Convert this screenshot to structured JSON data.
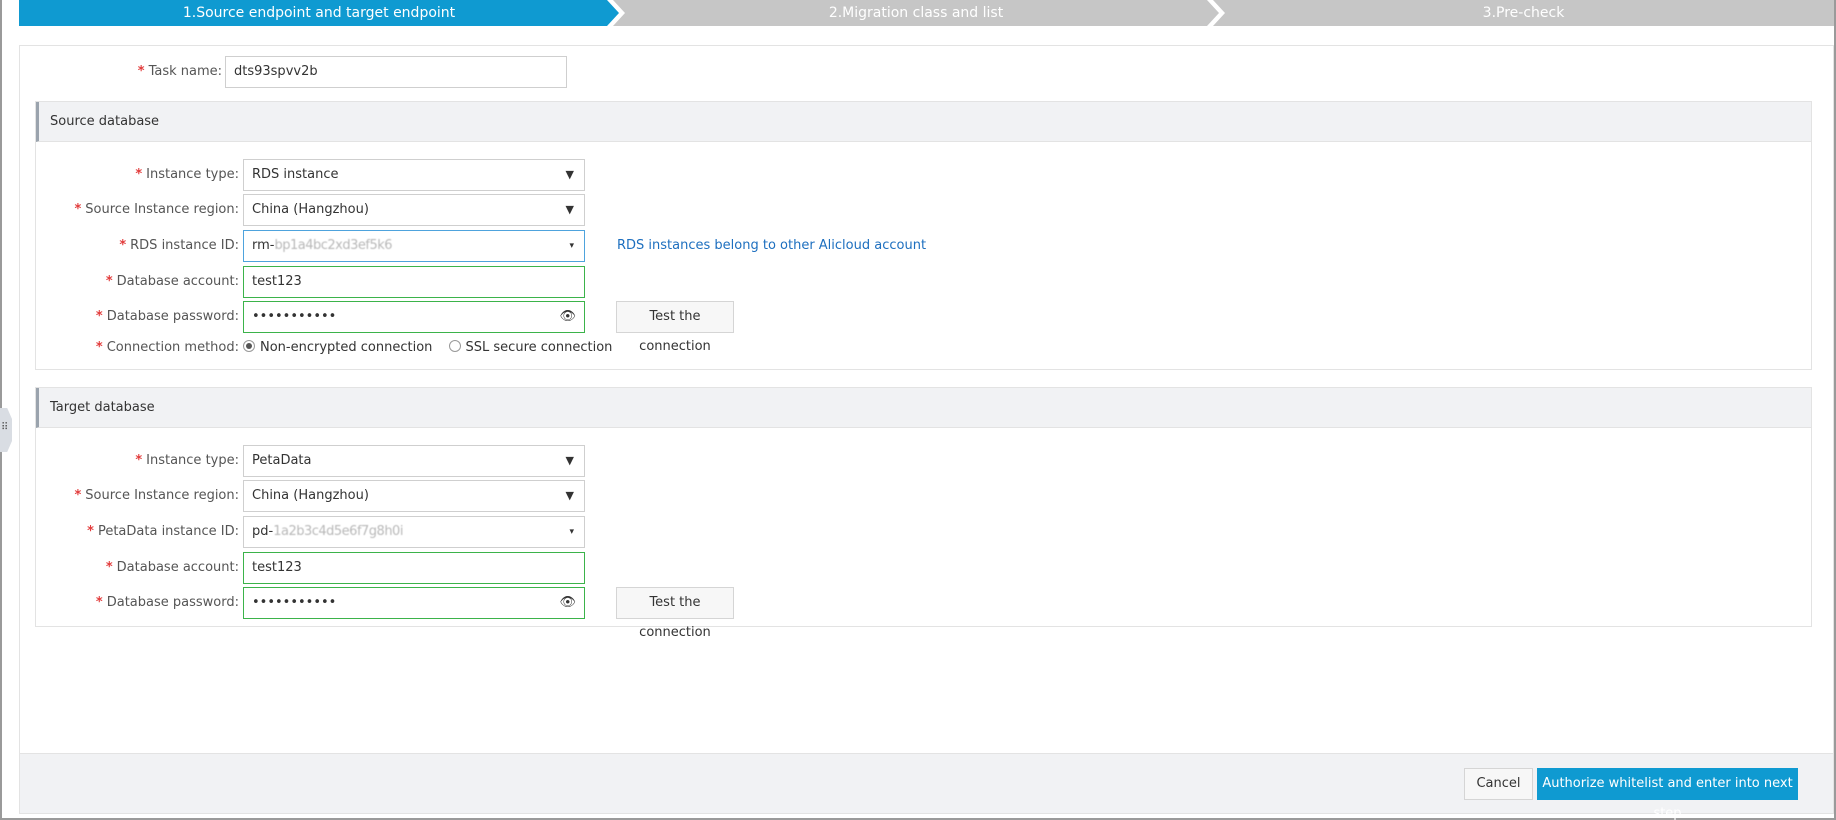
{
  "steps": [
    {
      "label": "1.Source endpoint and target endpoint"
    },
    {
      "label": "2.Migration class and list"
    },
    {
      "label": "3.Pre-check"
    }
  ],
  "task": {
    "label": "Task name:",
    "value": "dts93spvv2b"
  },
  "source": {
    "title": "Source database",
    "instance_type": {
      "label": "Instance type:",
      "value": "RDS instance"
    },
    "region": {
      "label": "Source Instance region:",
      "value": "China (Hangzhou)"
    },
    "instance_id": {
      "label": "RDS instance ID:",
      "value_prefix": "rm-",
      "value_masked": "bp1a4bc2xd3ef5k6"
    },
    "other_account_link": "RDS instances belong to other Alicloud account",
    "account": {
      "label": "Database account:",
      "value": "test123"
    },
    "password": {
      "label": "Database password:",
      "value": "•••••••••••"
    },
    "test_button": "Test the connection",
    "connection": {
      "label": "Connection method:",
      "options": [
        "Non-encrypted connection",
        "SSL secure connection"
      ],
      "selected": "Non-encrypted connection"
    }
  },
  "target": {
    "title": "Target database",
    "instance_type": {
      "label": "Instance type:",
      "value": "PetaData"
    },
    "region": {
      "label": "Source Instance region:",
      "value": "China (Hangzhou)"
    },
    "instance_id": {
      "label": "PetaData instance ID:",
      "value_prefix": "pd-",
      "value_masked": "1a2b3c4d5e6f7g8h0i"
    },
    "account": {
      "label": "Database account:",
      "value": "test123"
    },
    "password": {
      "label": "Database password:",
      "value": "•••••••••••"
    },
    "test_button": "Test the connection"
  },
  "footer": {
    "cancel": "Cancel",
    "next": "Authorize whitelist and enter into next step"
  },
  "icons": {
    "dropdown": "▼",
    "caret_small": "▾",
    "eye": "👁",
    "required": "*",
    "handle": "⠿"
  },
  "colors": {
    "primary": "#0f9ad1",
    "step_inactive": "#c6c6c6",
    "valid_border": "#3bb34a",
    "link": "#1d6fbf",
    "required": "#e23c3c"
  }
}
